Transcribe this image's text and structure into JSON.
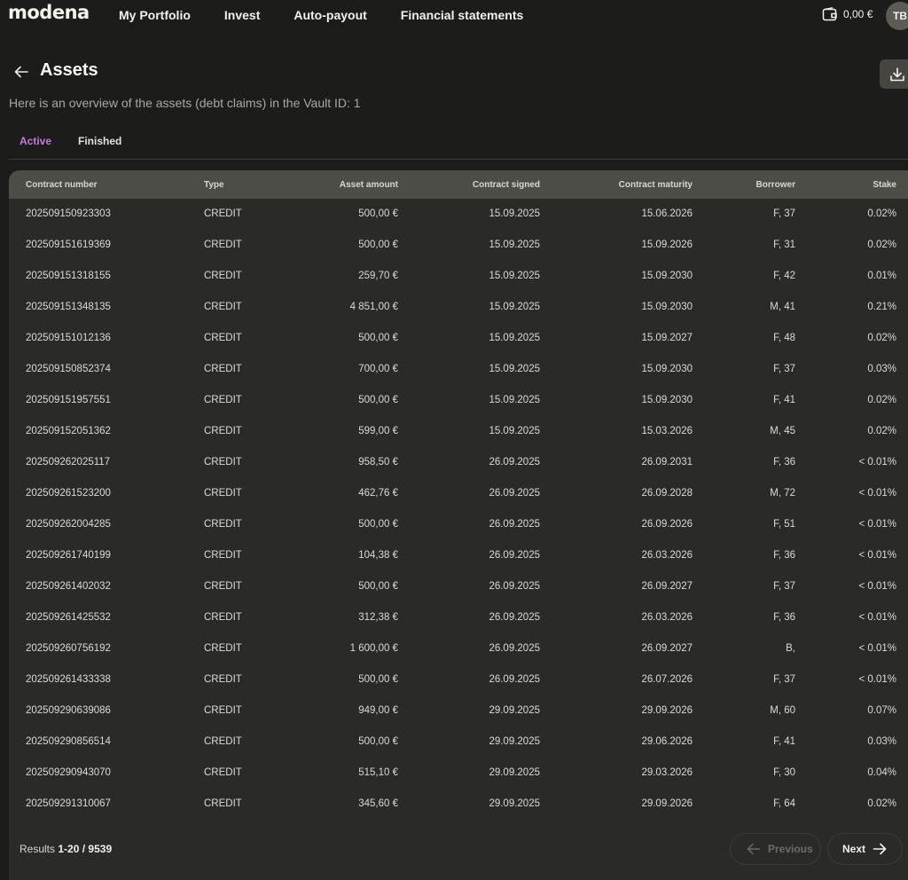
{
  "brand": "modena",
  "nav": [
    "My Portfolio",
    "Invest",
    "Auto-payout",
    "Financial statements"
  ],
  "wallet": {
    "balance": "0,00 €"
  },
  "user": {
    "initials": "TB"
  },
  "page": {
    "title": "Assets",
    "subtitle": "Here is an overview of the assets (debt claims) in the Vault ID: 1"
  },
  "tabs": {
    "active": "Active",
    "finished": "Finished"
  },
  "table": {
    "headers": [
      "Contract number",
      "Type",
      "Asset amount",
      "Contract signed",
      "Contract maturity",
      "Borrower",
      "Stake"
    ],
    "rows": [
      [
        "202509150923303",
        "CREDIT",
        "500,00 €",
        "15.09.2025",
        "15.06.2026",
        "F, 37",
        "0.02%"
      ],
      [
        "202509151619369",
        "CREDIT",
        "500,00 €",
        "15.09.2025",
        "15.09.2026",
        "F, 31",
        "0.02%"
      ],
      [
        "202509151318155",
        "CREDIT",
        "259,70 €",
        "15.09.2025",
        "15.09.2030",
        "F, 42",
        "0.01%"
      ],
      [
        "202509151348135",
        "CREDIT",
        "4 851,00 €",
        "15.09.2025",
        "15.09.2030",
        "M, 41",
        "0.21%"
      ],
      [
        "202509151012136",
        "CREDIT",
        "500,00 €",
        "15.09.2025",
        "15.09.2027",
        "F, 48",
        "0.02%"
      ],
      [
        "202509150852374",
        "CREDIT",
        "700,00 €",
        "15.09.2025",
        "15.09.2030",
        "F, 37",
        "0.03%"
      ],
      [
        "202509151957551",
        "CREDIT",
        "500,00 €",
        "15.09.2025",
        "15.09.2030",
        "F, 41",
        "0.02%"
      ],
      [
        "202509152051362",
        "CREDIT",
        "599,00 €",
        "15.09.2025",
        "15.03.2026",
        "M, 45",
        "0.02%"
      ],
      [
        "202509262025117",
        "CREDIT",
        "958,50 €",
        "26.09.2025",
        "26.09.2031",
        "F, 36",
        "< 0.01%"
      ],
      [
        "202509261523200",
        "CREDIT",
        "462,76 €",
        "26.09.2025",
        "26.09.2028",
        "M, 72",
        "< 0.01%"
      ],
      [
        "202509262004285",
        "CREDIT",
        "500,00 €",
        "26.09.2025",
        "26.09.2026",
        "F, 51",
        "< 0.01%"
      ],
      [
        "202509261740199",
        "CREDIT",
        "104,38 €",
        "26.09.2025",
        "26.03.2026",
        "F, 36",
        "< 0.01%"
      ],
      [
        "202509261402032",
        "CREDIT",
        "500,00 €",
        "26.09.2025",
        "26.09.2027",
        "F, 37",
        "< 0.01%"
      ],
      [
        "202509261425532",
        "CREDIT",
        "312,38 €",
        "26.09.2025",
        "26.03.2026",
        "F, 36",
        "< 0.01%"
      ],
      [
        "202509260756192",
        "CREDIT",
        "1 600,00 €",
        "26.09.2025",
        "26.09.2027",
        "B,",
        "< 0.01%"
      ],
      [
        "202509261433338",
        "CREDIT",
        "500,00 €",
        "26.09.2025",
        "26.07.2026",
        "F, 37",
        "< 0.01%"
      ],
      [
        "202509290639086",
        "CREDIT",
        "949,00 €",
        "29.09.2025",
        "29.09.2026",
        "M, 60",
        "0.07%"
      ],
      [
        "202509290856514",
        "CREDIT",
        "500,00 €",
        "29.09.2025",
        "29.06.2026",
        "F, 41",
        "0.03%"
      ],
      [
        "202509290943070",
        "CREDIT",
        "515,10 €",
        "29.09.2025",
        "29.03.2026",
        "F, 30",
        "0.04%"
      ],
      [
        "202509291310067",
        "CREDIT",
        "345,60 €",
        "29.09.2025",
        "29.09.2026",
        "F, 64",
        "0.02%"
      ]
    ]
  },
  "pagination": {
    "results_label": "Results",
    "range": "1-20",
    "separator": "/",
    "total": "9539",
    "previous": "Previous",
    "next": "Next"
  },
  "colors": {
    "accent": "#c47ae0",
    "background": "#1c1c1a",
    "table_bg": "#2a2a27",
    "header_bg": "#4d4d47"
  }
}
